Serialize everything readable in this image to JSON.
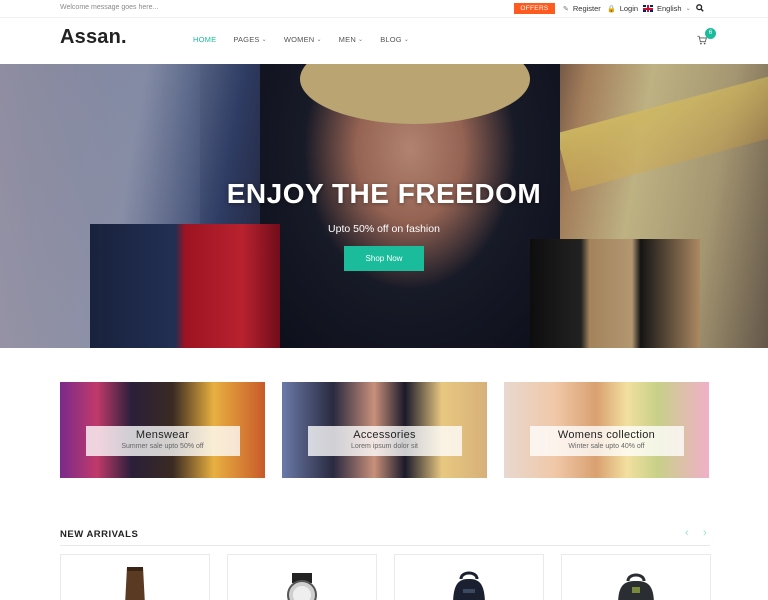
{
  "topbar": {
    "welcome": "Welcome message goes here...",
    "offers_label": "OFFERS",
    "register_label": "Register",
    "login_label": "Login",
    "language": "English"
  },
  "header": {
    "logo": "Assan.",
    "nav": [
      {
        "label": "HOME",
        "active": true
      },
      {
        "label": "PAGES",
        "has_dropdown": true
      },
      {
        "label": "WOMEN",
        "has_dropdown": true
      },
      {
        "label": "MEN",
        "has_dropdown": true
      },
      {
        "label": "BLOG",
        "has_dropdown": true
      }
    ],
    "cart_count": "6"
  },
  "hero": {
    "title": "ENJOY THE FREEDOM",
    "subtitle": "Upto 50% off on fashion",
    "button_label": "Shop Now"
  },
  "promos": [
    {
      "title": "Menswear",
      "subtitle": "Summer sale upto 50% off"
    },
    {
      "title": "Accessories",
      "subtitle": "Lorem ipsum dolor sit"
    },
    {
      "title": "Womens collection",
      "subtitle": "Winter sale upto 40% off"
    }
  ],
  "new_arrivals": {
    "title": "NEW ARRIVALS",
    "products": [
      {
        "icon": "skirt-product-image"
      },
      {
        "icon": "watch-product-image"
      },
      {
        "icon": "backpack-product-image"
      },
      {
        "icon": "bag-product-image"
      }
    ]
  },
  "colors": {
    "accent": "#1abc9c",
    "offers": "#ff5a1f"
  }
}
